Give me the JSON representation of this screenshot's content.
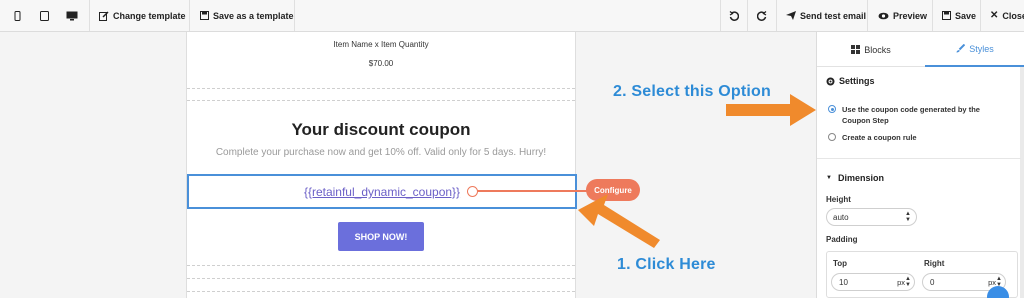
{
  "toolbar": {
    "change_template": "Change template",
    "save_as_template": "Save as a template",
    "send_test_email": "Send test email",
    "preview": "Preview",
    "save": "Save",
    "close": "Close"
  },
  "email": {
    "item_name_line": "Item Name x Item Quantity",
    "item_price": "$70.00",
    "coupon_title": "Your discount coupon",
    "coupon_subtitle": "Complete your purchase now and get 10% off. Valid only for 5 days. Hurry!",
    "coupon_code": "{{retainful_dynamic_coupon}}",
    "shop_button": "SHOP NOW!",
    "configure_badge": "Configure"
  },
  "panel": {
    "tab_blocks": "Blocks",
    "tab_styles": "Styles",
    "settings_heading": "Settings",
    "option_generated_line1": "Use the coupon code generated by the",
    "option_generated_line2": "Coupon Step",
    "option_rule": "Create a coupon rule",
    "selected_option": "Use the coupon code generated by the Coupon Step",
    "dimension_heading": "Dimension",
    "height_label": "Height",
    "height_value": "auto",
    "padding_label": "Padding",
    "top_label": "Top",
    "top_value": "10",
    "right_label": "Right",
    "right_value": "0",
    "unit": "px"
  },
  "annotations": {
    "step1": "1. Click Here",
    "step2": "2. Select this Option"
  },
  "colors": {
    "accent_blue": "#4a90d9",
    "annotation_blue": "#2d8bd6",
    "arrow_orange": "#f08a2c",
    "configure_orange": "#ee7a5c",
    "button_purple": "#6b6fdc",
    "coupon_text": "#6b5fc7"
  }
}
